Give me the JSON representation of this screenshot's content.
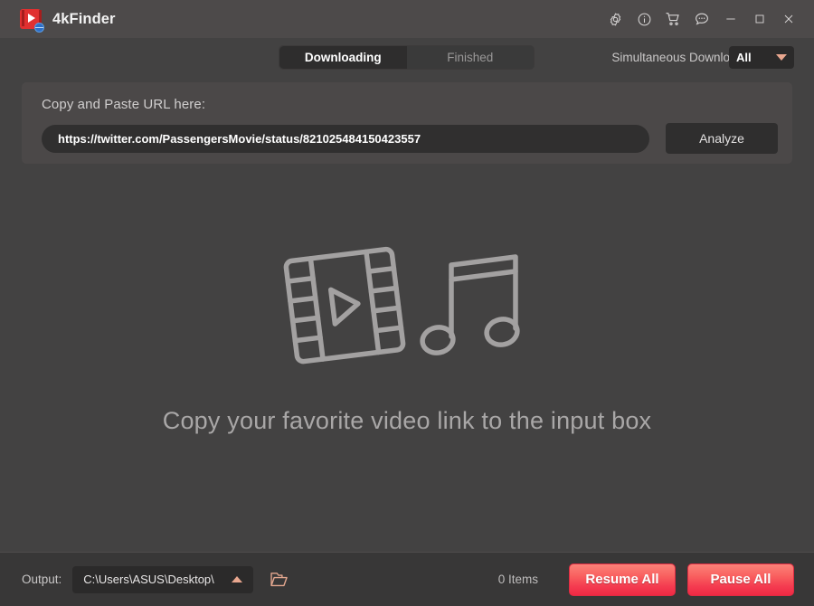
{
  "window": {
    "app_title": "4kFinder",
    "logo_icon": "app-logo-film-play-globe",
    "controls": [
      {
        "name": "settings-gear-icon",
        "label": "Settings"
      },
      {
        "name": "info-icon",
        "label": "Info"
      },
      {
        "name": "cart-icon",
        "label": "Buy"
      },
      {
        "name": "feedback-bubble-icon",
        "label": "Feedback"
      },
      {
        "name": "minimize-icon",
        "label": "Minimize"
      },
      {
        "name": "maximize-icon",
        "label": "Maximize"
      },
      {
        "name": "close-icon",
        "label": "Close"
      }
    ]
  },
  "tabs": [
    {
      "label": "Downloading",
      "active": true
    },
    {
      "label": "Finished",
      "active": false
    }
  ],
  "simultaneous": {
    "label": "Simultaneous Download",
    "value": "All",
    "caret_color": "#E9A78F"
  },
  "url_panel": {
    "caption": "Copy and Paste URL here:",
    "url_value": "https://twitter.com/PassengersMovie/status/821025484150423557",
    "url_placeholder": "Copy and Paste URL here",
    "analyze_label": "Analyze"
  },
  "empty_state": {
    "message": "Copy your favorite video link to the input box",
    "illustration": "film-strip-and-music-note"
  },
  "bottom_bar": {
    "output_label": "Output:",
    "output_path": "C:\\Users\\ASUS\\Desktop\\",
    "folder_icon": "open-folder-icon",
    "item_count": "0 Items",
    "resume_all_label": "Resume All",
    "pause_all_label": "Pause All"
  },
  "colors": {
    "window_bg": "#434242",
    "titlebar_bg": "#4D4A4A",
    "card_bg": "#4B4848",
    "input_bg": "#302F2F",
    "bottom_bg": "#383737",
    "accent_red": "#F43B50",
    "accent_salmon": "#E9A78F",
    "muted_text": "#A9A7A7"
  }
}
